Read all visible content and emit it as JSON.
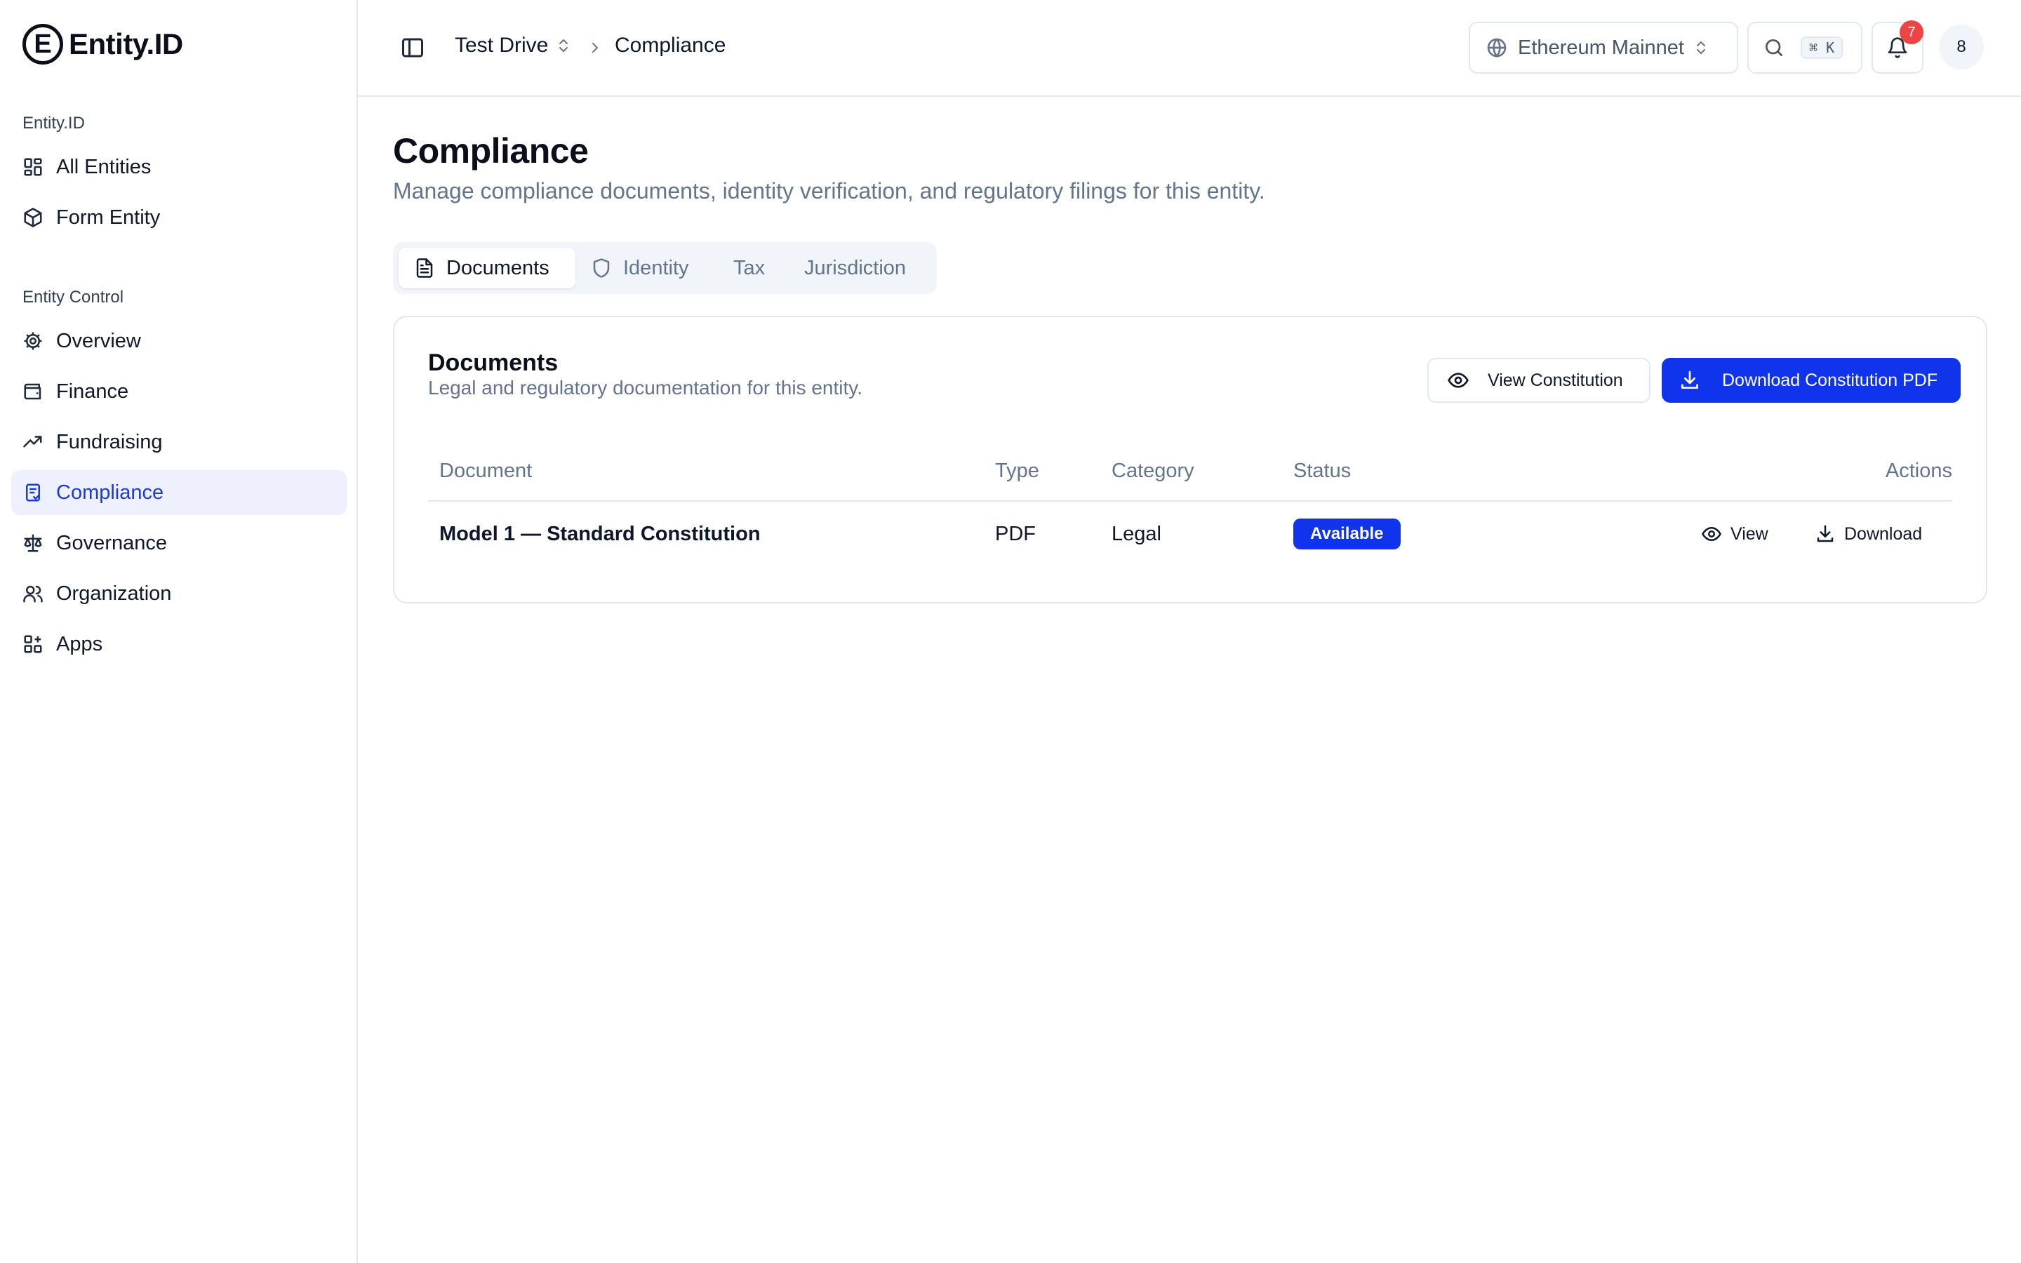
{
  "brand": {
    "mark": "E",
    "name": "Entity.ID"
  },
  "sidebar": {
    "group1_label": "Entity.ID",
    "group1_items": [
      {
        "label": "All Entities",
        "icon": "grid-icon"
      },
      {
        "label": "Form Entity",
        "icon": "cube-icon"
      }
    ],
    "group2_label": "Entity Control",
    "group2_items": [
      {
        "label": "Overview",
        "icon": "gear-icon"
      },
      {
        "label": "Finance",
        "icon": "wallet-icon"
      },
      {
        "label": "Fundraising",
        "icon": "trending-up-icon"
      },
      {
        "label": "Compliance",
        "icon": "clipboard-check-icon",
        "active": true
      },
      {
        "label": "Governance",
        "icon": "scale-icon"
      },
      {
        "label": "Organization",
        "icon": "users-icon"
      },
      {
        "label": "Apps",
        "icon": "apps-icon"
      }
    ]
  },
  "header": {
    "breadcrumb": [
      "Test Drive",
      "Compliance"
    ],
    "network": "Ethereum Mainnet",
    "search_shortcut": "⌘ K",
    "notifications_count": "7",
    "avatar_text": "8"
  },
  "page": {
    "title": "Compliance",
    "subtitle": "Manage compliance documents, identity verification, and regulatory filings for this entity."
  },
  "tabs": [
    {
      "label": "Documents",
      "active": true
    },
    {
      "label": "Identity"
    },
    {
      "label": "Tax"
    },
    {
      "label": "Jurisdiction"
    }
  ],
  "documents_card": {
    "title": "Documents",
    "subtitle": "Legal and regulatory documentation for this entity.",
    "view_button": "View Constitution",
    "download_button": "Download Constitution PDF",
    "columns": [
      "Document",
      "Type",
      "Category",
      "Status",
      "Actions"
    ],
    "rows": [
      {
        "document": "Model 1 — Standard Constitution",
        "type": "PDF",
        "category": "Legal",
        "status": "Available",
        "view": "View",
        "download": "Download"
      }
    ]
  },
  "colors": {
    "accent": "#1034ec",
    "active_nav_bg": "#eef1fd",
    "badge_red": "#ef4444"
  }
}
